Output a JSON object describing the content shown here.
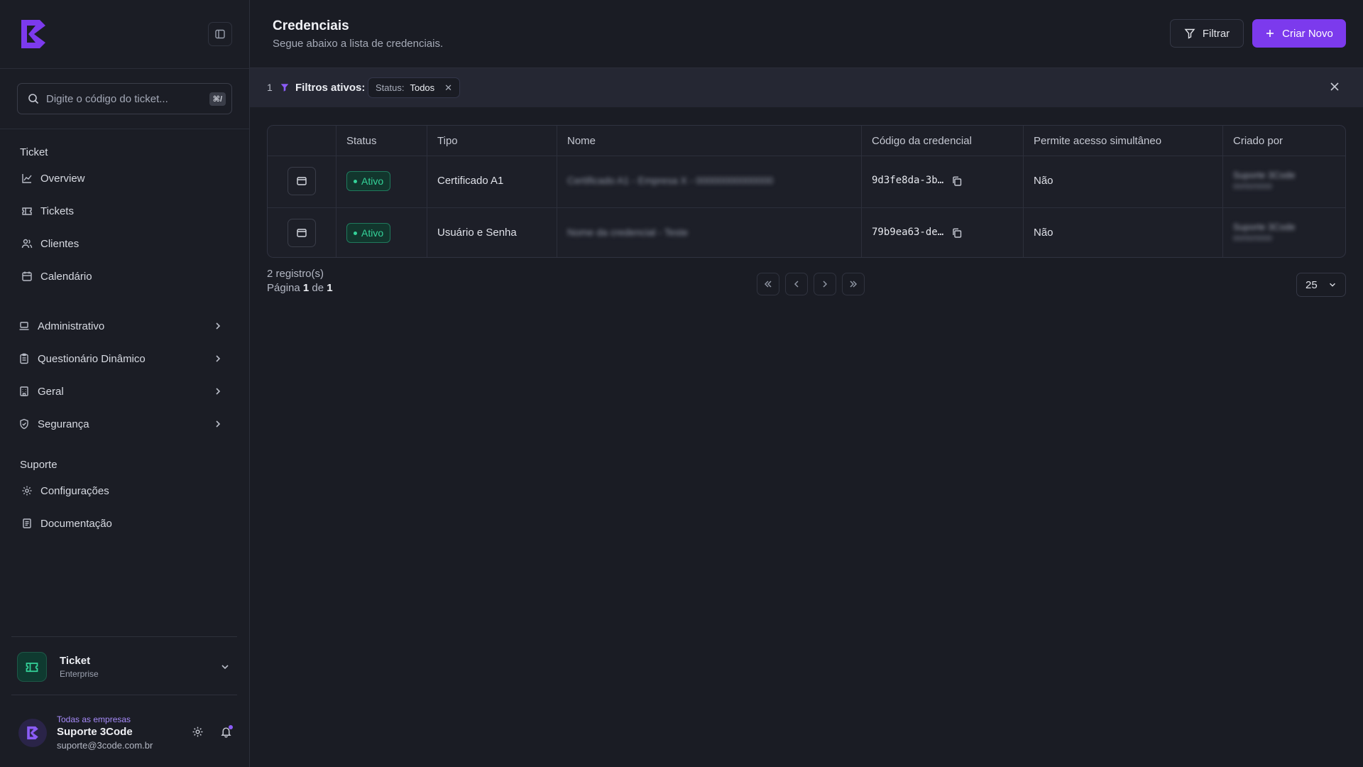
{
  "sidebar": {
    "search_placeholder": "Digite o código do ticket...",
    "search_shortcut": "⌘/",
    "section_ticket": "Ticket",
    "ticket_items": [
      {
        "label": "Overview",
        "icon": "chart-line-icon"
      },
      {
        "label": "Tickets",
        "icon": "ticket-icon"
      },
      {
        "label": "Clientes",
        "icon": "users-icon"
      },
      {
        "label": "Calendário",
        "icon": "calendar-icon"
      }
    ],
    "groups": [
      {
        "label": "Administrativo",
        "icon": "laptop-icon"
      },
      {
        "label": "Questionário Dinâmico",
        "icon": "clipboard-icon"
      },
      {
        "label": "Geral",
        "icon": "building-icon"
      },
      {
        "label": "Segurança",
        "icon": "shield-icon"
      }
    ],
    "section_support": "Suporte",
    "support_items": [
      {
        "label": "Configurações",
        "icon": "gear-icon"
      },
      {
        "label": "Documentação",
        "icon": "document-icon"
      }
    ],
    "org": {
      "name": "Ticket",
      "plan": "Enterprise"
    },
    "user": {
      "scope": "Todas as empresas",
      "name": "Suporte 3Code",
      "email": "suporte@3code.com.br"
    }
  },
  "header": {
    "title": "Credenciais",
    "subtitle": "Segue abaixo a lista de credenciais.",
    "filter_label": "Filtrar",
    "new_label": "Criar Novo"
  },
  "filters": {
    "count": "1",
    "label": "Filtros ativos:",
    "chip_key": "Status:",
    "chip_value": "Todos"
  },
  "table": {
    "columns": [
      "Status",
      "Tipo",
      "Nome",
      "Código da credencial",
      "Permite acesso simultâneo",
      "Criado por"
    ],
    "rows": [
      {
        "status": "Ativo",
        "tipo": "Certificado A1",
        "nome": "Certificado A1 - Empresa X - 00000000000000",
        "codigo": "9d3fe8da-3b…",
        "simultaneo": "Não",
        "criado_por": "Suporte 3Code",
        "criado_em": "00/00/0000"
      },
      {
        "status": "Ativo",
        "tipo": "Usuário e Senha",
        "nome": "Nome da credencial - Teste",
        "codigo": "79b9ea63-de…",
        "simultaneo": "Não",
        "criado_por": "Suporte 3Code",
        "criado_em": "00/00/0000"
      }
    ]
  },
  "pagination": {
    "records": "2 registro(s)",
    "page_prefix": "Página",
    "page_current": "1",
    "page_of": "de",
    "page_total": "1",
    "page_size": "25"
  },
  "colors": {
    "accent": "#7c3aed",
    "active_green": "#34d399",
    "background": "#1a1c24"
  }
}
